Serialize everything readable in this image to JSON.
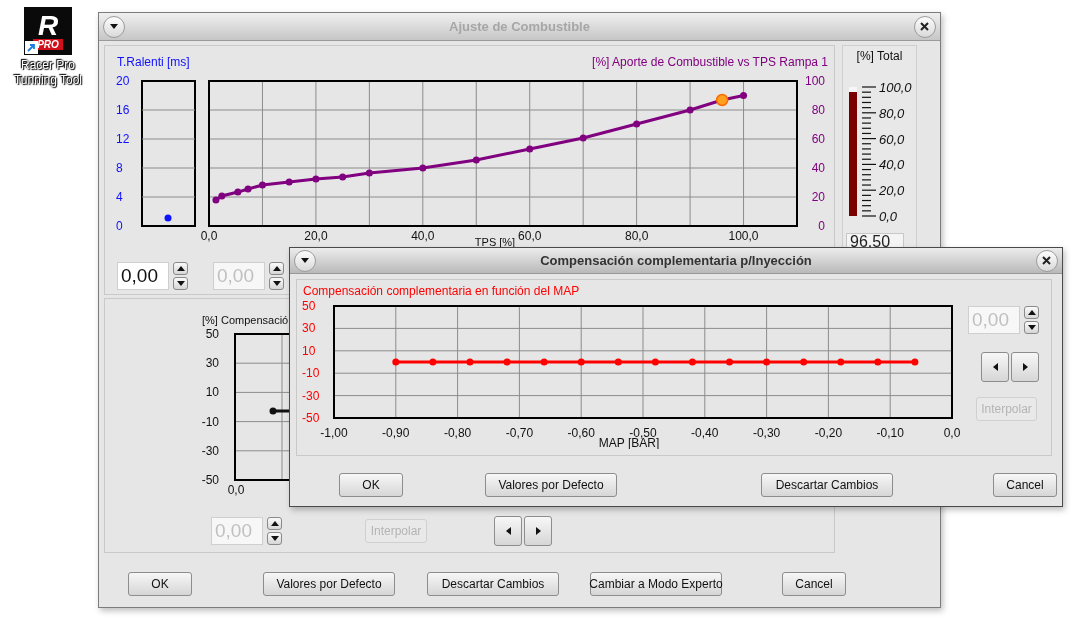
{
  "desktop_icon": {
    "logo_letter": "R",
    "logo_badge": "PRO",
    "label": "Racer Pro Tunning Tool"
  },
  "main_window": {
    "title": "Ajuste de Combustible",
    "active": false,
    "idle_panel": {
      "label": "T.Ralenti [ms]",
      "y_tick_labels": [
        "20",
        "16",
        "12",
        "8",
        "4",
        "0"
      ]
    },
    "fuel_panel": {
      "points": [
        {
          "selected": false
        },
        {
          "selected": false
        },
        {
          "selected": false
        },
        {
          "selected": false
        },
        {
          "selected": false
        },
        {
          "selected": false
        },
        {
          "selected": false
        },
        {
          "selected": false
        },
        {
          "selected": false
        },
        {
          "selected": false
        },
        {
          "selected": false
        },
        {
          "selected": false
        },
        {
          "selected": false
        },
        {
          "selected": false
        },
        {
          "selected": false
        },
        {
          "selected": true
        },
        {
          "selected": false
        }
      ],
      "chart_data": {
        "type": "line",
        "title": "[%] Aporte de Combustible vs TPS Rampa 1",
        "xlabel": "TPS [%]",
        "grid": true,
        "marker": true,
        "x": [
          1.3,
          2.4,
          5.4,
          7.3,
          10,
          15,
          20,
          25,
          30,
          40,
          50,
          60,
          70,
          80,
          90,
          96,
          100
        ],
        "values": [
          18,
          20.7,
          23.4,
          25.5,
          28.3,
          30.3,
          32.4,
          33.8,
          36.6,
          40,
          45.5,
          53.1,
          60.7,
          70.3,
          80,
          86.9,
          90
        ],
        "xlim": [
          0,
          110
        ],
        "ylim": [
          0,
          100
        ],
        "xticks": [
          {
            "value": 0,
            "label": "0,0"
          },
          {
            "value": 20,
            "label": "20,0"
          },
          {
            "value": 40,
            "label": "40,0"
          },
          {
            "value": 60,
            "label": "60,0"
          },
          {
            "value": 80,
            "label": "80,0"
          },
          {
            "value": 100,
            "label": "100,0"
          }
        ],
        "yticks": [
          0,
          20,
          40,
          60,
          80,
          100
        ]
      }
    },
    "spin_boxes": [
      {
        "value": "0,00",
        "disabled": false
      },
      {
        "value": "0,00",
        "disabled": true
      }
    ],
    "total": {
      "title": "[%] Total",
      "level": 0.965,
      "scale": [
        "100,0",
        "80,0",
        "60,0",
        "40,0",
        "20,0",
        "0,0"
      ],
      "value": "96,50"
    },
    "compensation": {
      "title": "[%] Compensació",
      "y_tick_labels": [
        "50",
        "30",
        "10",
        "-10",
        "-30",
        "-50"
      ],
      "x_tick_label": "0,0",
      "spin": {
        "value": "0,00",
        "disabled": true
      },
      "interpolate": {
        "label": "Interpolar",
        "disabled": true
      }
    },
    "buttons": [
      "OK",
      "Valores por Defecto",
      "Descartar Cambios",
      "Cambiar a Modo Experto",
      "Cancel"
    ]
  },
  "dialog": {
    "title": "Compensación complementaria p/Inyección",
    "active": true,
    "chart_data": {
      "type": "line",
      "title": "Compensación complementaria en función del MAP",
      "xlabel": "MAP [BAR]",
      "grid": true,
      "marker": true,
      "x": [
        -0.9,
        -0.84,
        -0.78,
        -0.72,
        -0.66,
        -0.6,
        -0.54,
        -0.48,
        -0.42,
        -0.36,
        -0.3,
        -0.24,
        -0.18,
        -0.12,
        -0.06
      ],
      "values": [
        0,
        0,
        0,
        0,
        0,
        0,
        0,
        0,
        0,
        0,
        0,
        0,
        0,
        0,
        0
      ],
      "xlim": [
        -1,
        0
      ],
      "ylim": [
        -50,
        50
      ],
      "xticks": [
        {
          "value": -1,
          "label": "-1,00"
        },
        {
          "value": -0.9,
          "label": "-0,90"
        },
        {
          "value": -0.8,
          "label": "-0,80"
        },
        {
          "value": -0.7,
          "label": "-0,70"
        },
        {
          "value": -0.6,
          "label": "-0,60"
        },
        {
          "value": -0.5,
          "label": "-0,50"
        },
        {
          "value": -0.4,
          "label": "-0,40"
        },
        {
          "value": -0.3,
          "label": "-0,30"
        },
        {
          "value": -0.2,
          "label": "-0,20"
        },
        {
          "value": -0.1,
          "label": "-0,10"
        },
        {
          "value": 0,
          "label": "0,0"
        }
      ],
      "yticks": [
        50,
        30,
        10,
        -10,
        -30,
        -50
      ]
    },
    "spin": {
      "value": "0,00",
      "disabled": true
    },
    "interpolate": {
      "label": "Interpolar",
      "disabled": true
    },
    "buttons": [
      "OK",
      "Valores por Defecto",
      "Descartar Cambios",
      "Cancel"
    ]
  }
}
